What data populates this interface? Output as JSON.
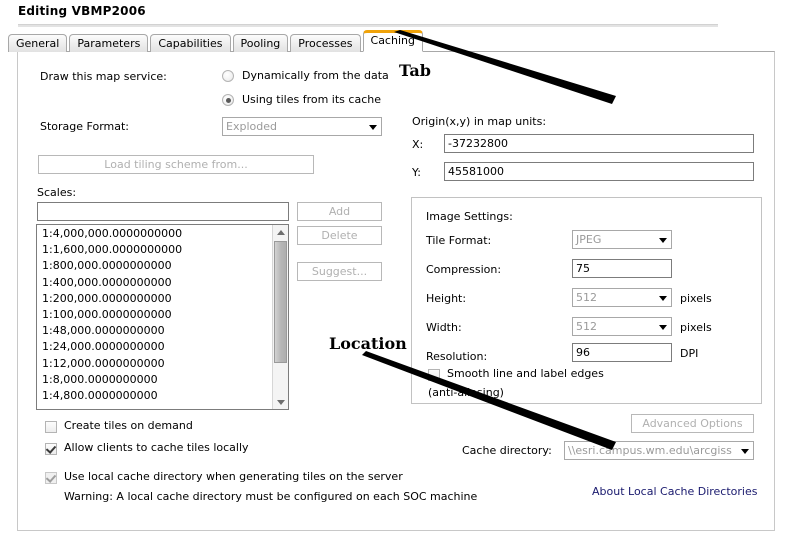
{
  "window": {
    "title": "Editing VBMP2006"
  },
  "tabs": [
    {
      "label": "General",
      "active": false
    },
    {
      "label": "Parameters",
      "active": false
    },
    {
      "label": "Capabilities",
      "active": false
    },
    {
      "label": "Pooling",
      "active": false
    },
    {
      "label": "Processes",
      "active": false
    },
    {
      "label": "Caching",
      "active": true
    }
  ],
  "draw_service": {
    "label": "Draw this map service:",
    "options": [
      {
        "label": "Dynamically from the data",
        "selected": false
      },
      {
        "label": "Using tiles from its cache",
        "selected": true
      }
    ]
  },
  "storage": {
    "label": "Storage Format:",
    "value": "Exploded",
    "disabled": true
  },
  "load_tiling_scheme": {
    "label": "Load tiling scheme from...",
    "disabled": true
  },
  "scales": {
    "label": "Scales:",
    "input_value": "",
    "input_placeholder": "",
    "items": [
      "1:4,000,000.0000000000",
      "1:1,600,000.0000000000",
      "1:800,000.0000000000",
      "1:400,000.0000000000",
      "1:200,000.0000000000",
      "1:100,000.0000000000",
      "1:48,000.0000000000",
      "1:24,000.0000000000",
      "1:12,000.0000000000",
      "1:8,000.0000000000",
      "1:4,800.0000000000"
    ],
    "buttons": {
      "add": "Add",
      "delete": "Delete",
      "suggest": "Suggest..."
    }
  },
  "origin": {
    "label": "Origin(x,y) in map units:",
    "x_label": "X:",
    "x_value": "-37232800",
    "y_label": "Y:",
    "y_value": "45581000"
  },
  "image_settings": {
    "title": "Image Settings:",
    "tile_format": {
      "label": "Tile Format:",
      "value": "JPEG",
      "disabled": true
    },
    "compression": {
      "label": "Compression:",
      "value": "75"
    },
    "height": {
      "label": "Height:",
      "value": "512",
      "unit": "pixels",
      "disabled": true
    },
    "width": {
      "label": "Width:",
      "value": "512",
      "unit": "pixels",
      "disabled": true
    },
    "resolution": {
      "label": "Resolution:",
      "value": "96",
      "unit": "DPI"
    },
    "antialias": {
      "line1": "Smooth line and label edges",
      "line2": "(anti-aliasing)",
      "checked": false
    }
  },
  "checkboxes": {
    "create_tiles": {
      "label": "Create tiles on demand",
      "checked": false,
      "disabled": false
    },
    "allow_clients": {
      "label": "Allow clients to cache tiles locally",
      "checked": true,
      "disabled": false
    },
    "use_local_dir": {
      "label": "Use local cache directory when generating tiles on the server",
      "checked": true,
      "disabled": true
    },
    "warning": "Warning: A local cache directory must be configured on each SOC machine"
  },
  "advanced_options": {
    "label": "Advanced Options",
    "disabled": true
  },
  "cache_directory": {
    "label": "Cache directory:",
    "value": "\\\\esri.campus.wm.edu\\arcgiss"
  },
  "about_link": {
    "label": "About Local Cache Directories"
  },
  "annotations": [
    {
      "text": "Tab",
      "target": "caching-tab"
    },
    {
      "text": "Location",
      "target": "cache-directory-combo"
    }
  ],
  "colors": {
    "active_tab_accent": "#f0a30a",
    "link": "#1a1a6e",
    "annotation": "#000000"
  }
}
